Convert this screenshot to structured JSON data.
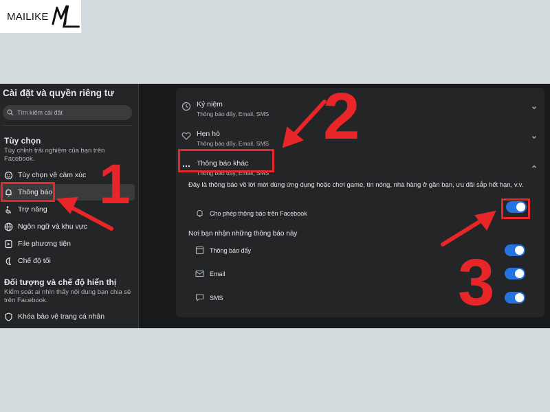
{
  "brand": {
    "name": "MAILIKE",
    "mark_letters": "ML"
  },
  "sidebar": {
    "title": "Cài đặt và quyền riêng tư",
    "search_placeholder": "Tìm kiếm cài đặt",
    "section1": {
      "title": "Tùy chọn",
      "desc": "Tùy chỉnh trải nghiệm của bạn trên Facebook."
    },
    "items": [
      {
        "label": "Tùy chọn về cảm xúc",
        "icon": "reactions-icon"
      },
      {
        "label": "Thông báo",
        "icon": "bell-icon",
        "active": true
      },
      {
        "label": "Trợ năng",
        "icon": "accessibility-icon"
      },
      {
        "label": "Ngôn ngữ và khu vực",
        "icon": "globe-icon"
      },
      {
        "label": "File phương tiện",
        "icon": "media-icon"
      },
      {
        "label": "Chế độ tối",
        "icon": "moon-icon"
      }
    ],
    "section2": {
      "title": "Đối tượng và chế độ hiển thị",
      "desc": "Kiểm soát ai nhìn thấy nội dung bạn chia sẻ trên Facebook."
    },
    "item_profile_lock": {
      "label": "Khóa bảo vệ trang cá nhân",
      "icon": "shield-icon"
    }
  },
  "main": {
    "rows": [
      {
        "title": "Kỷ niệm",
        "subtitle": "Thông báo đẩy, Email, SMS",
        "icon": "history-icon",
        "expanded": false
      },
      {
        "title": "Hẹn hò",
        "subtitle": "Thông báo đẩy, Email, SMS",
        "icon": "heart-icon",
        "expanded": false
      },
      {
        "title": "Thông báo khác",
        "subtitle": "Thông báo đẩy, Email, SMS",
        "icon": "more-icon",
        "expanded": true
      }
    ],
    "description": "Đây là thông báo về lời mời dùng ứng dụng hoặc chơi game, tin nóng, nhà hàng ở gần bạn, ưu đãi sắp hết hạn, v.v.",
    "allow_toggle": {
      "label": "Cho phép thông báo trên Facebook",
      "on": true
    },
    "channels_heading": "Nơi bạn nhận những thông báo này",
    "channels": [
      {
        "label": "Thông báo đẩy",
        "icon": "push-icon",
        "on": true
      },
      {
        "label": "Email",
        "icon": "mail-icon",
        "on": true
      },
      {
        "label": "SMS",
        "icon": "sms-icon",
        "on": true
      }
    ]
  },
  "annotations": {
    "step1": "1",
    "step2": "2",
    "step3": "3",
    "color": "#e8262a"
  },
  "colors": {
    "accent": "#2374e1",
    "panel": "#242526",
    "background": "#18191a",
    "annotation": "#e8262a"
  }
}
